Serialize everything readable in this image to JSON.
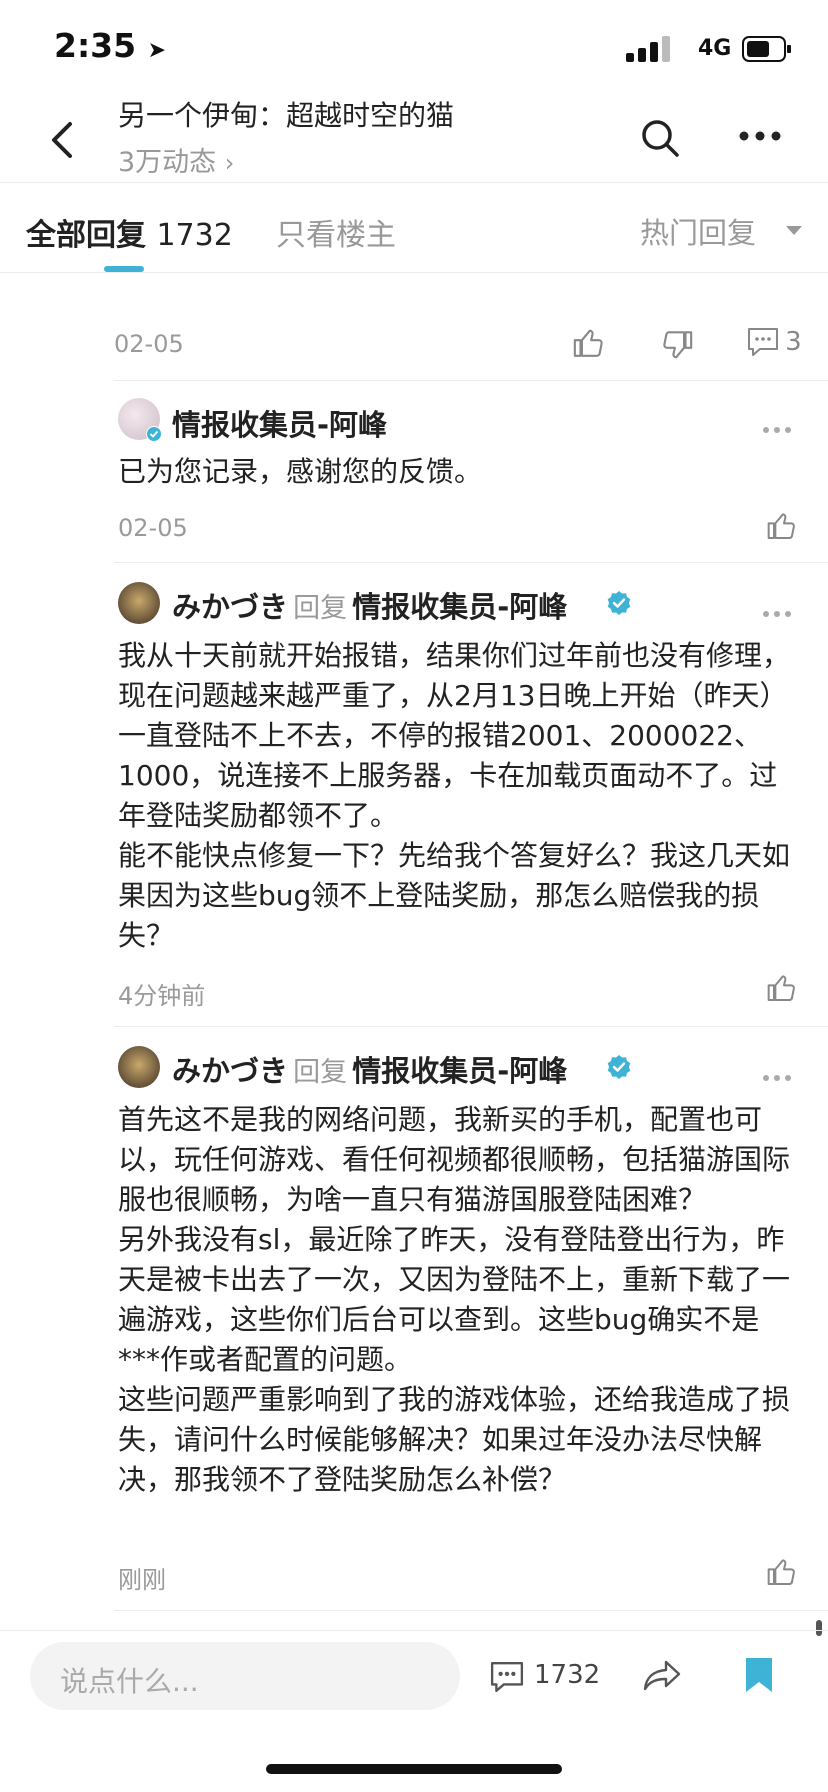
{
  "status": {
    "time": "2:35",
    "network": "4G"
  },
  "nav": {
    "title": "另一个伊甸：超越时空的猫",
    "subtitle": "3万动态"
  },
  "tabs": {
    "all_label": "全部回复",
    "all_count": "1732",
    "op_label": "只看楼主",
    "sort_label": "热门回复"
  },
  "prev": {
    "date": "02-05",
    "comment_count": "3"
  },
  "comments": [
    {
      "user": "情报收集员-阿峰",
      "text": "已为您记录，感谢您的反馈。",
      "time": "02-05"
    },
    {
      "user": "みかづき",
      "reply_word": "回复",
      "reply_to": "情报收集员-阿峰",
      "text": "我从十天前就开始报错，结果你们过年前也没有修理，现在问题越来越严重了，从2月13日晚上开始（昨天）一直登陆不上不去，不停的报错2001、2000022、1000，说连接不上服务器，卡在加载页面动不了。过年登陆奖励都领不了。\n能不能快点修复一下？先给我个答复好么？我这几天如果因为这些bug领不上登陆奖励，那怎么赔偿我的损失？",
      "time": "4分钟前"
    },
    {
      "user": "みかづき",
      "reply_word": "回复",
      "reply_to": "情报收集员-阿峰",
      "text": "首先这不是我的网络问题，我新买的手机，配置也可以，玩任何游戏、看任何视频都很顺畅，包括猫游国际服也很顺畅，为啥一直只有猫游国服登陆困难？\n另外我没有sl，最近除了昨天，没有登陆登出行为，昨天是被卡出去了一次，又因为登陆不上，重新下载了一遍游戏，这些你们后台可以查到。这些bug确实不是***作或者配置的问题。\n这些问题严重影响到了我的游戏体验，还给我造成了损失，请问什么时候能够解决？如果过年没办法尽快解决，那我领不了登陆奖励怎么补偿？",
      "time": "刚刚"
    }
  ],
  "bottom": {
    "input_placeholder": "说点什么...",
    "comment_count": "1732"
  },
  "colors": {
    "accent": "#3fb3d6",
    "gray_text": "#9a9a9a",
    "divider": "#ececec"
  }
}
